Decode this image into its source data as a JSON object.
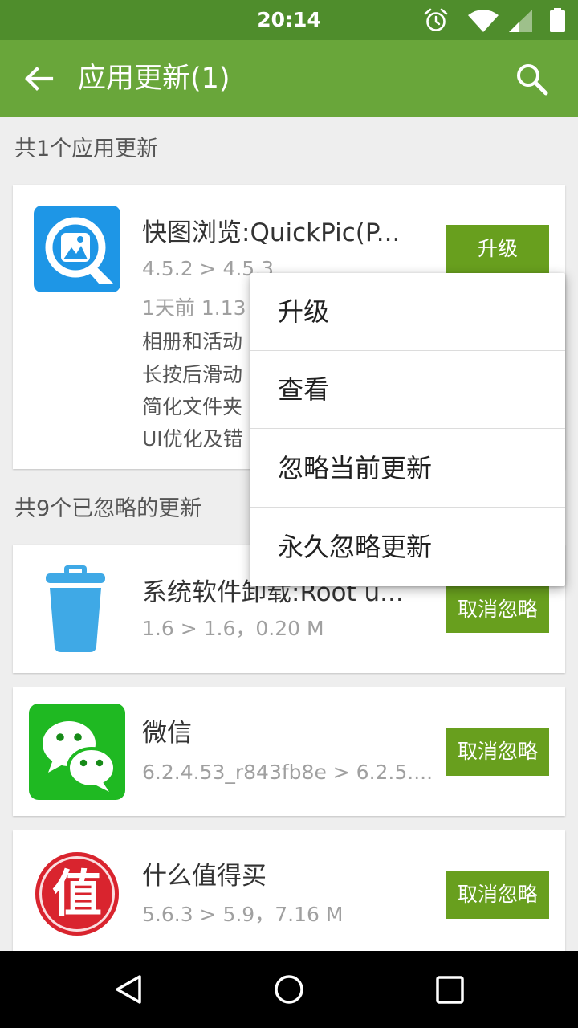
{
  "colors": {
    "status_bar": "#4f8d2c",
    "app_bar": "#69a63a",
    "button": "#689f1e",
    "background": "#eeeeee",
    "nav_bar": "#000000"
  },
  "status_bar": {
    "time": "20:14",
    "icons": [
      "alarm-icon",
      "wifi-icon",
      "signal-icon",
      "battery-icon"
    ]
  },
  "app_bar": {
    "title": "应用更新(1)",
    "back_icon": "arrow-back-icon",
    "search_icon": "search-icon"
  },
  "updates_section": {
    "header": "共1个应用更新",
    "apps": [
      {
        "icon": "quickpic-icon",
        "title": "快图浏览:QuickPic(P...",
        "version": "4.5.2 > 4.5.3",
        "meta": "1天前  1.13",
        "notes": [
          "相册和活动",
          "长按后滑动",
          "简化文件夹",
          "UI优化及错"
        ],
        "button": "升级"
      }
    ]
  },
  "popup_menu": {
    "items": [
      "升级",
      "查看",
      "忽略当前更新",
      "永久忽略更新"
    ]
  },
  "ignored_section": {
    "header": "共9个已忽略的更新",
    "apps": [
      {
        "icon": "trash-icon",
        "title": "系统软件卸载:Root u...",
        "info": "1.6 > 1.6，0.20 M",
        "button": "取消忽略"
      },
      {
        "icon": "wechat-icon",
        "title": "微信",
        "info": "6.2.4.53_r843fb8e > 6.2.5....",
        "button": "取消忽略"
      },
      {
        "icon": "smzdm-icon",
        "icon_text": "值",
        "title": "什么值得买",
        "info": "5.6.3 > 5.9，7.16 M",
        "button": "取消忽略"
      }
    ]
  },
  "nav_bar": {
    "icons": [
      "nav-back-icon",
      "nav-home-icon",
      "nav-recents-icon"
    ]
  }
}
